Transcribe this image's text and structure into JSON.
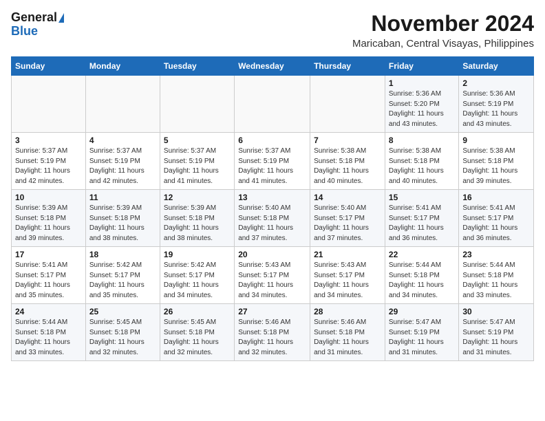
{
  "header": {
    "logo_line1": "General",
    "logo_line2": "Blue",
    "month": "November 2024",
    "location": "Maricaban, Central Visayas, Philippines"
  },
  "weekdays": [
    "Sunday",
    "Monday",
    "Tuesday",
    "Wednesday",
    "Thursday",
    "Friday",
    "Saturday"
  ],
  "weeks": [
    [
      {
        "day": "",
        "info": ""
      },
      {
        "day": "",
        "info": ""
      },
      {
        "day": "",
        "info": ""
      },
      {
        "day": "",
        "info": ""
      },
      {
        "day": "",
        "info": ""
      },
      {
        "day": "1",
        "info": "Sunrise: 5:36 AM\nSunset: 5:20 PM\nDaylight: 11 hours\nand 43 minutes."
      },
      {
        "day": "2",
        "info": "Sunrise: 5:36 AM\nSunset: 5:19 PM\nDaylight: 11 hours\nand 43 minutes."
      }
    ],
    [
      {
        "day": "3",
        "info": "Sunrise: 5:37 AM\nSunset: 5:19 PM\nDaylight: 11 hours\nand 42 minutes."
      },
      {
        "day": "4",
        "info": "Sunrise: 5:37 AM\nSunset: 5:19 PM\nDaylight: 11 hours\nand 42 minutes."
      },
      {
        "day": "5",
        "info": "Sunrise: 5:37 AM\nSunset: 5:19 PM\nDaylight: 11 hours\nand 41 minutes."
      },
      {
        "day": "6",
        "info": "Sunrise: 5:37 AM\nSunset: 5:19 PM\nDaylight: 11 hours\nand 41 minutes."
      },
      {
        "day": "7",
        "info": "Sunrise: 5:38 AM\nSunset: 5:18 PM\nDaylight: 11 hours\nand 40 minutes."
      },
      {
        "day": "8",
        "info": "Sunrise: 5:38 AM\nSunset: 5:18 PM\nDaylight: 11 hours\nand 40 minutes."
      },
      {
        "day": "9",
        "info": "Sunrise: 5:38 AM\nSunset: 5:18 PM\nDaylight: 11 hours\nand 39 minutes."
      }
    ],
    [
      {
        "day": "10",
        "info": "Sunrise: 5:39 AM\nSunset: 5:18 PM\nDaylight: 11 hours\nand 39 minutes."
      },
      {
        "day": "11",
        "info": "Sunrise: 5:39 AM\nSunset: 5:18 PM\nDaylight: 11 hours\nand 38 minutes."
      },
      {
        "day": "12",
        "info": "Sunrise: 5:39 AM\nSunset: 5:18 PM\nDaylight: 11 hours\nand 38 minutes."
      },
      {
        "day": "13",
        "info": "Sunrise: 5:40 AM\nSunset: 5:18 PM\nDaylight: 11 hours\nand 37 minutes."
      },
      {
        "day": "14",
        "info": "Sunrise: 5:40 AM\nSunset: 5:17 PM\nDaylight: 11 hours\nand 37 minutes."
      },
      {
        "day": "15",
        "info": "Sunrise: 5:41 AM\nSunset: 5:17 PM\nDaylight: 11 hours\nand 36 minutes."
      },
      {
        "day": "16",
        "info": "Sunrise: 5:41 AM\nSunset: 5:17 PM\nDaylight: 11 hours\nand 36 minutes."
      }
    ],
    [
      {
        "day": "17",
        "info": "Sunrise: 5:41 AM\nSunset: 5:17 PM\nDaylight: 11 hours\nand 35 minutes."
      },
      {
        "day": "18",
        "info": "Sunrise: 5:42 AM\nSunset: 5:17 PM\nDaylight: 11 hours\nand 35 minutes."
      },
      {
        "day": "19",
        "info": "Sunrise: 5:42 AM\nSunset: 5:17 PM\nDaylight: 11 hours\nand 34 minutes."
      },
      {
        "day": "20",
        "info": "Sunrise: 5:43 AM\nSunset: 5:17 PM\nDaylight: 11 hours\nand 34 minutes."
      },
      {
        "day": "21",
        "info": "Sunrise: 5:43 AM\nSunset: 5:17 PM\nDaylight: 11 hours\nand 34 minutes."
      },
      {
        "day": "22",
        "info": "Sunrise: 5:44 AM\nSunset: 5:18 PM\nDaylight: 11 hours\nand 34 minutes."
      },
      {
        "day": "23",
        "info": "Sunrise: 5:44 AM\nSunset: 5:18 PM\nDaylight: 11 hours\nand 33 minutes."
      }
    ],
    [
      {
        "day": "24",
        "info": "Sunrise: 5:44 AM\nSunset: 5:18 PM\nDaylight: 11 hours\nand 33 minutes."
      },
      {
        "day": "25",
        "info": "Sunrise: 5:45 AM\nSunset: 5:18 PM\nDaylight: 11 hours\nand 32 minutes."
      },
      {
        "day": "26",
        "info": "Sunrise: 5:45 AM\nSunset: 5:18 PM\nDaylight: 11 hours\nand 32 minutes."
      },
      {
        "day": "27",
        "info": "Sunrise: 5:46 AM\nSunset: 5:18 PM\nDaylight: 11 hours\nand 32 minutes."
      },
      {
        "day": "28",
        "info": "Sunrise: 5:46 AM\nSunset: 5:18 PM\nDaylight: 11 hours\nand 31 minutes."
      },
      {
        "day": "29",
        "info": "Sunrise: 5:47 AM\nSunset: 5:19 PM\nDaylight: 11 hours\nand 31 minutes."
      },
      {
        "day": "30",
        "info": "Sunrise: 5:47 AM\nSunset: 5:19 PM\nDaylight: 11 hours\nand 31 minutes."
      }
    ]
  ]
}
